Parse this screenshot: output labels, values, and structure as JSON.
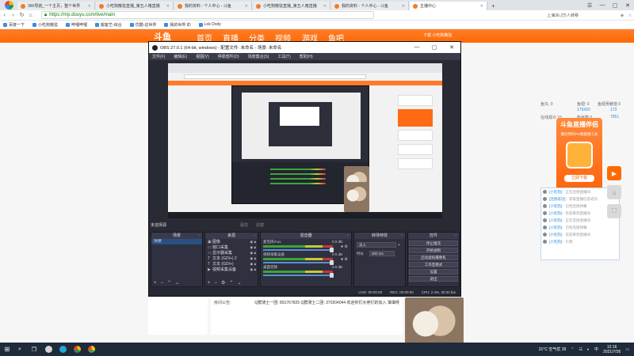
{
  "browser": {
    "tabs": [
      {
        "title": "360导航_一个主页，整个世界",
        "active": false
      },
      {
        "title": "小吃狗散弦直播_第五人格直播",
        "active": false
      },
      {
        "title": "我的资料 - 个人中心 - 斗鱼",
        "active": false
      },
      {
        "title": "小吃狗散弦直播_第五人格直播",
        "active": false
      },
      {
        "title": "我的资料 - 个人中心 - 斗鱼",
        "active": false
      },
      {
        "title": "主播中心",
        "active": true
      }
    ],
    "new_tab": "+",
    "url": "https://mp.douyu.com/live/main",
    "toolbar_right": "上海36.2万人转移",
    "bookmarks": [
      "百度一下",
      "小吃狗散弦",
      "哔哩哔哩",
      "搬客艺-综合",
      "优酷-这世界",
      "我的世界 的",
      "Lok Dody"
    ]
  },
  "site": {
    "logo": "斗鱼",
    "nav": [
      "首页",
      "直播",
      "分类",
      "视频",
      "游戏",
      "鱼吧"
    ],
    "user_area": "下载   小吃狗散弦",
    "stats": [
      "鱼丸: 0",
      "鱼翅: 0",
      "在线观众 15",
      "粉丝数 0",
      "鱼翅贡献值 0"
    ],
    "stat_values": [
      "173",
      "179420",
      "7951"
    ],
    "promo": {
      "title": "斗鱼直播伴侣",
      "subtitle": "最好用的PC端直播工具",
      "button": "立即下载"
    },
    "chat": [
      {
        "user": "[小吃狗]",
        "text": "：正在连接直播间"
      },
      {
        "user": "[连接成功]",
        "text": "：获取直播信息成功"
      },
      {
        "user": "[小吃狗]",
        "text": "：已经连接弹幕"
      },
      {
        "user": "[小吃狗]",
        "text": "：欢迎来到直播间"
      },
      {
        "user": "[小吃狗]",
        "text": "：正在连接直播间"
      },
      {
        "user": "[小吃狗]",
        "text": "：已经连接弹幕"
      },
      {
        "user": "[小吃狗]",
        "text": "：欢迎来到直播间"
      },
      {
        "user": "[小吃狗]",
        "text": "：礼物"
      }
    ],
    "announcement_label": "房间公告:",
    "announcement": "Q群骑士一团: 891767825  Q群骑士二团: 370204044  欢迎你们大佬们的加入 蔼蔼呀"
  },
  "obs": {
    "title": "OBS 27.0.1 (64-bit, windows) - 配置文件: 未命名 - 场景: 未命名",
    "menu": [
      "文件(F)",
      "编辑(E)",
      "视图(V)",
      "停靠部件(D)",
      "场景集合(S)",
      "工具(T)",
      "帮助(H)"
    ],
    "no_source": "未选择源",
    "toggles": [
      "属性",
      "滤镜"
    ],
    "docks": {
      "scenes": "场景",
      "sources": "来源",
      "mixer": "混音器",
      "transitions": "转场特效",
      "controls": "控件"
    },
    "scenes_list": [
      "场景"
    ],
    "sources_list": [
      {
        "name": "图像",
        "icon": "▣"
      },
      {
        "name": "窗口采集",
        "icon": "▭"
      },
      {
        "name": "显示器采集",
        "icon": "▭"
      },
      {
        "name": "文本 (GDI+) 2",
        "icon": "T"
      },
      {
        "name": "文本 (GDI+)",
        "icon": "T"
      },
      {
        "name": "视频采集设备",
        "icon": "▶"
      }
    ],
    "mixer_channels": [
      {
        "name": "麦克风/Aux",
        "db": "0.0 dB"
      },
      {
        "name": "视频采集设备",
        "db": "0.0 dB"
      },
      {
        "name": "桌面音频",
        "db": "0.0 dB"
      }
    ],
    "transition": {
      "type": "淡入",
      "duration_label": "时长",
      "duration": "300 ms"
    },
    "controls": [
      "停止推流",
      "开始录制",
      "启动虚拟摄像机",
      "工作室模式",
      "设置",
      "退出"
    ],
    "status": [
      "LIVE: 00:00:00",
      "REC: 00:00:00",
      "CPU: 2.3%, 30.00 fps"
    ]
  },
  "taskbar": {
    "weather": "31°C 空气优 39",
    "time": "12:16",
    "date": "2021/7/26",
    "lang": "中"
  }
}
